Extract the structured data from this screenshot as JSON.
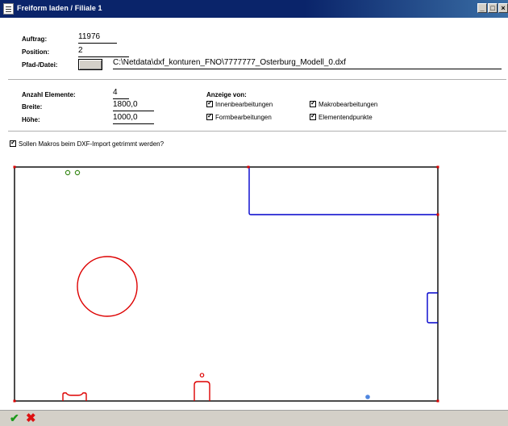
{
  "window": {
    "title": "Freiform laden / Filiale 1",
    "minimize": "_",
    "maximize": "□",
    "close": "×"
  },
  "order": {
    "auftrag_label": "Auftrag:",
    "auftrag_value": "11976",
    "position_label": "Position:",
    "position_value": "2",
    "pfad_label": "Pfad-/Datei:",
    "pfad_value": "C:\\Netdata\\dxf_konturen_FNO\\7777777_Osterburg_Modell_0.dxf"
  },
  "dimensions": {
    "anzahl_label": "Anzahl Elemente:",
    "anzahl_value": "4",
    "breite_label": "Breite:",
    "breite_value": "1800,0",
    "hoehe_label": "Höhe:",
    "hoehe_value": "1000,0"
  },
  "anzeige": {
    "header": "Anzeige von:",
    "options": [
      {
        "label": "Innenbearbeitungen",
        "checked": true
      },
      {
        "label": "Makrobearbeitungen",
        "checked": true
      },
      {
        "label": "Formbearbeitungen",
        "checked": true
      },
      {
        "label": "Elementendpunkte",
        "checked": true
      }
    ]
  },
  "makros_trimmen": {
    "label": "Sollen Makros beim DXF-Import getrimmt werden?",
    "checked": true
  },
  "drawing": {
    "colors": {
      "outline": "#000000",
      "red": "#dd0000",
      "blue": "#0000cc",
      "green": "#3a8a1a",
      "dot": "#4f86e0"
    }
  },
  "footer": {
    "ok_icon": "checkmark-icon",
    "cancel_icon": "x-icon",
    "ok_glyph": "✔",
    "cancel_glyph": "✖"
  }
}
